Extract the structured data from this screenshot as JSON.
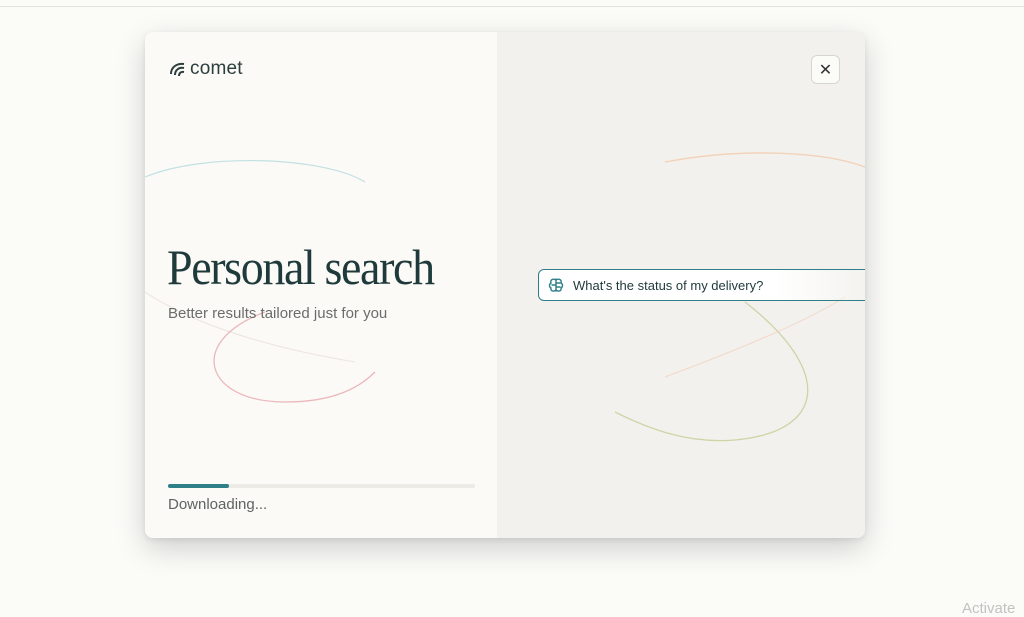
{
  "app": {
    "brand": "comet"
  },
  "hero": {
    "title": "Personal search",
    "subtitle": "Better results tailored just for you"
  },
  "progress": {
    "value": 0.2,
    "status": "Downloading..."
  },
  "preview": {
    "query": "What's the status of my delivery?"
  },
  "close": {
    "label": "✕"
  },
  "watermark": {
    "text": "Activate"
  },
  "colors": {
    "accent": "#2f7f88",
    "title": "#1f3a3b",
    "background": "#fbfbf8"
  },
  "icons": [
    "comet-logo-icon",
    "close-icon",
    "brain-icon"
  ]
}
